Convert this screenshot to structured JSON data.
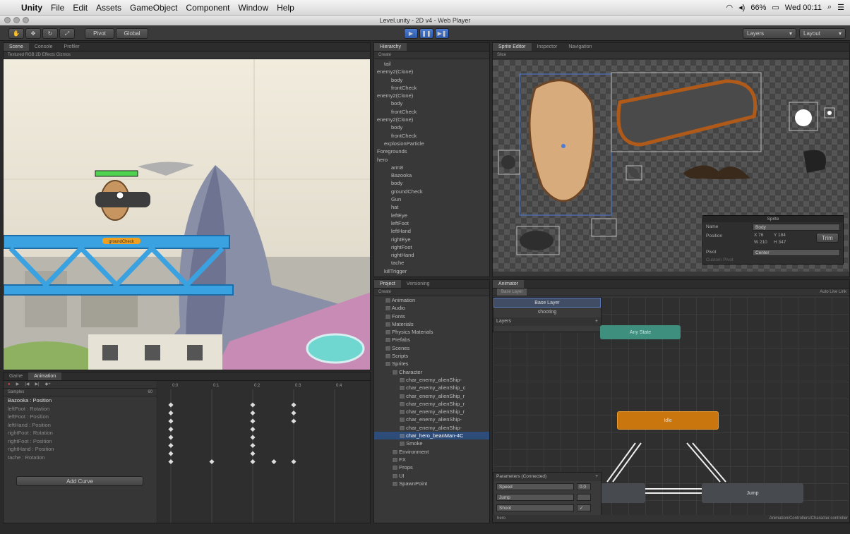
{
  "menubar": {
    "app": "Unity",
    "items": [
      "File",
      "Edit",
      "Assets",
      "GameObject",
      "Component",
      "Window",
      "Help"
    ],
    "status": "66%",
    "clock": "Wed 00:11"
  },
  "window": {
    "title": "Level.unity - 2D v4 - Web Player"
  },
  "toolbar": {
    "pivot": "Pivot",
    "global": "Global",
    "layers": "Layers",
    "layout": "Layout"
  },
  "scene": {
    "tabs": [
      "Scene",
      "Console",
      "Profiler"
    ],
    "subbar": "Textured     RGB    2D    Effects    Gizmos",
    "label": "groundCheck"
  },
  "hierarchy": {
    "tab": "Hierarchy",
    "create": "Create",
    "rows": [
      "tail",
      "enemy2(Clone)",
      "body",
      "frontCheck",
      "enemy2(Clone)",
      "body",
      "frontCheck",
      "enemy2(Clone)",
      "body",
      "frontCheck",
      "explosionParticle",
      "Foregrounds",
      "hero",
      "arm8",
      "Bazooka",
      "body",
      "groundCheck",
      "Gun",
      "hat",
      "leftEye",
      "leftFoot",
      "leftHand",
      "rightEye",
      "rightFoot",
      "rightHand",
      "tache",
      "killTrigger"
    ]
  },
  "sprite_editor": {
    "tabs": [
      "Sprite Editor",
      "Inspector",
      "Navigation"
    ],
    "slice": "Slice",
    "panel_title": "Sprite",
    "name_label": "Name",
    "name_value": "Body",
    "position_label": "Position",
    "x": "X 76",
    "y": "Y 184",
    "w": "W 210",
    "h": "H 347",
    "trim": "Trim",
    "pivot_label": "Pivot",
    "pivot_value": "Center",
    "custom_pivot": "Custom Pivot"
  },
  "project": {
    "tabs": [
      "Project",
      "Versioning"
    ],
    "create": "Create",
    "rows": [
      "Animation",
      "Audio",
      "Fonts",
      "Materials",
      "Physics Materials",
      "Prefabs",
      "Scenes",
      "Scripts",
      "Sprites",
      "Character",
      "char_enemy_alienShip-",
      "char_enemy_alienShip_c",
      "char_enemy_alienShip_r",
      "char_enemy_alienShip_r",
      "char_enemy_alienShip_r",
      "char_enemy_alienShip-",
      "char_enemy_alienShip-",
      "char_hero_beanMan-4C",
      "Smoke",
      "Environment",
      "FX",
      "Props",
      "UI",
      "SpawnPoint"
    ]
  },
  "animation": {
    "tabs": [
      "Game",
      "Animation"
    ],
    "samples": "Samples",
    "samples_value": "60",
    "ticks": [
      "0:0",
      "0:1",
      "0:2",
      "0:3",
      "0:4"
    ],
    "props": [
      "Bazooka : Position",
      "leftFoot : Rotation",
      "leftFoot : Position",
      "leftHand : Position",
      "rightFoot : Rotation",
      "rightFoot : Position",
      "rightHand : Position",
      "tache : Rotation"
    ],
    "add_curve": "Add Curve"
  },
  "animator": {
    "tab": "Animator",
    "breadcrumb": "Base Layer",
    "autolive": "Auto Live Link",
    "layers": [
      "Base Layer",
      "shooting"
    ],
    "layers_header": "Layers",
    "any_state": "Any State",
    "idle": "Idle",
    "jump": "Jump",
    "params_header": "Parameters (Connected)",
    "params": [
      {
        "name": "Speed",
        "value": "0.0"
      },
      {
        "name": "Jump",
        "value": ""
      },
      {
        "name": "Shoot",
        "value": "✓"
      }
    ],
    "footer_left": "hero",
    "footer_right": "Animation/Controllers/Character.controller"
  }
}
